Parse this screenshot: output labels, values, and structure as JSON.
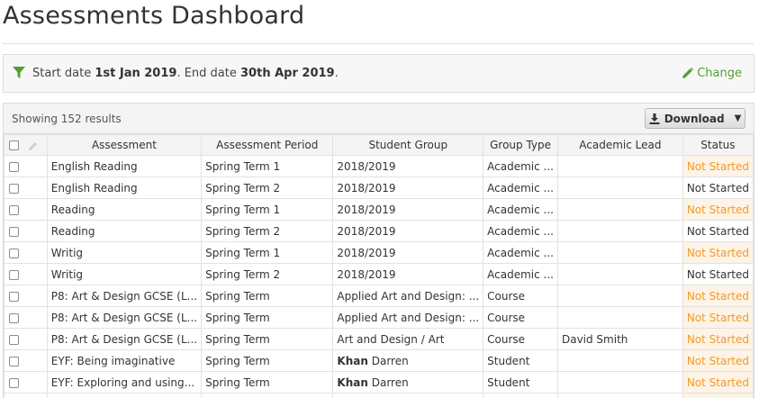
{
  "page": {
    "title": "Assessments Dashboard"
  },
  "filter": {
    "start_label": "Start date",
    "start_date": "1st Jan 2019",
    "end_label": ". End date",
    "end_date": "30th Apr 2019",
    "end_punct": ".",
    "change_label": "Change",
    "icon": "filter-icon",
    "accent": "#52a038"
  },
  "results": {
    "count_label": "Showing 152 results",
    "download_label": "Download"
  },
  "table": {
    "columns": [
      "",
      "Assessment",
      "Assessment Period",
      "Student Group",
      "Group Type",
      "Academic Lead",
      "Status"
    ],
    "rows": [
      {
        "assessment": "English Reading",
        "period": "Spring Term 1",
        "group": "2018/2019",
        "group_bold": "",
        "type": "Academic ...",
        "lead": "",
        "status": "Not Started",
        "highlight": true
      },
      {
        "assessment": "English Reading",
        "period": "Spring Term 2",
        "group": "2018/2019",
        "group_bold": "",
        "type": "Academic ...",
        "lead": "",
        "status": "Not Started",
        "highlight": false
      },
      {
        "assessment": "Reading",
        "period": "Spring Term 1",
        "group": "2018/2019",
        "group_bold": "",
        "type": "Academic ...",
        "lead": "",
        "status": "Not Started",
        "highlight": true
      },
      {
        "assessment": "Reading",
        "period": "Spring Term 2",
        "group": "2018/2019",
        "group_bold": "",
        "type": "Academic ...",
        "lead": "",
        "status": "Not Started",
        "highlight": false
      },
      {
        "assessment": "Writig",
        "period": "Spring Term 1",
        "group": "2018/2019",
        "group_bold": "",
        "type": "Academic ...",
        "lead": "",
        "status": "Not Started",
        "highlight": true
      },
      {
        "assessment": "Writig",
        "period": "Spring Term 2",
        "group": "2018/2019",
        "group_bold": "",
        "type": "Academic ...",
        "lead": "",
        "status": "Not Started",
        "highlight": false
      },
      {
        "assessment": "P8: Art & Design GCSE (L...",
        "period": "Spring Term",
        "group": "Applied Art and Design: ...",
        "group_bold": "",
        "type": "Course",
        "lead": "",
        "status": "Not Started",
        "highlight": true
      },
      {
        "assessment": "P8: Art & Design GCSE (L...",
        "period": "Spring Term",
        "group": "Applied Art and Design: ...",
        "group_bold": "",
        "type": "Course",
        "lead": "",
        "status": "Not Started",
        "highlight": true
      },
      {
        "assessment": "P8: Art & Design GCSE (L...",
        "period": "Spring Term",
        "group": "Art and Design / Art",
        "group_bold": "",
        "type": "Course",
        "lead": "David Smith",
        "status": "Not Started",
        "highlight": true
      },
      {
        "assessment": "EYF: Being imaginative",
        "period": "Spring Term",
        "group": "Darren",
        "group_bold": "Khan",
        "type": "Student",
        "lead": "",
        "status": "Not Started",
        "highlight": true
      },
      {
        "assessment": "EYF: Exploring and using...",
        "period": "Spring Term",
        "group": "Darren",
        "group_bold": "Khan",
        "type": "Student",
        "lead": "",
        "status": "Not Started",
        "highlight": true
      },
      {
        "assessment": "",
        "period": "",
        "group": "",
        "group_bold": "",
        "type": "",
        "lead": "",
        "status": "",
        "highlight": true
      }
    ]
  },
  "colors": {
    "not_started": "#f29a28",
    "not_started_bg": "#fdf3e6"
  }
}
